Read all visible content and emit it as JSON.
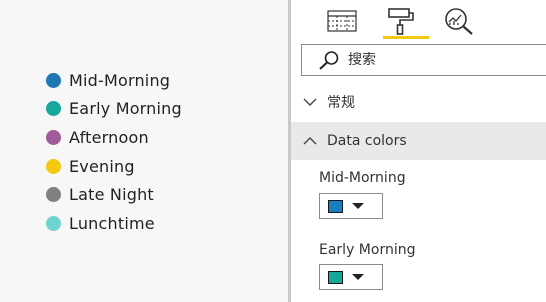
{
  "legend": {
    "items": [
      {
        "label": "Mid-Morning",
        "color": "#1f77b4"
      },
      {
        "label": "Early Morning",
        "color": "#17a89a"
      },
      {
        "label": "Afternoon",
        "color": "#a05c9a"
      },
      {
        "label": "Evening",
        "color": "#f2c811"
      },
      {
        "label": "Late Night",
        "color": "#808080"
      },
      {
        "label": "Lunchtime",
        "color": "#6fd3d0"
      }
    ]
  },
  "pane": {
    "tabs": [
      {
        "icon": "fields-table-icon",
        "active": false
      },
      {
        "icon": "paint-roller-icon",
        "active": true
      },
      {
        "icon": "analytics-magnifier-icon",
        "active": false
      }
    ],
    "accent_color": "#f2c811",
    "search": {
      "placeholder": "搜索"
    },
    "sections": {
      "general": {
        "title": "常规",
        "expanded": false
      },
      "data_colors": {
        "title": "Data colors",
        "expanded": true
      }
    },
    "color_fields": [
      {
        "label": "Mid-Morning",
        "color": "#1a7fc0"
      },
      {
        "label": "Early Morning",
        "color": "#14a89a"
      }
    ]
  }
}
